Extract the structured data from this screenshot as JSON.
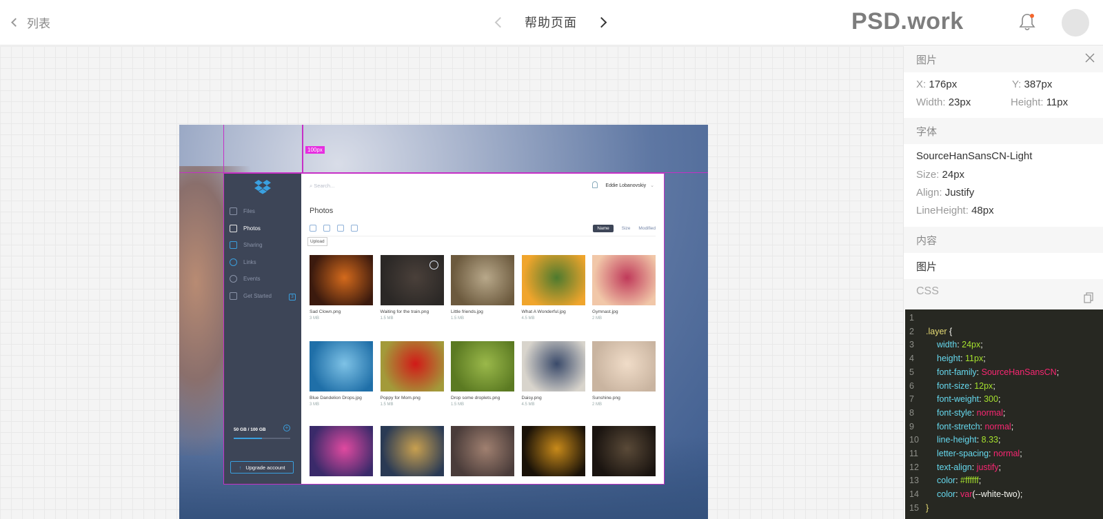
{
  "topbar": {
    "back_label": "列表",
    "page_title": "帮助页面",
    "brand": "PSD.work"
  },
  "artboard": {
    "measure_label": "100px",
    "app": {
      "search_placeholder": "Search...",
      "user_name": "Eddie Lobanovskiy",
      "title": "Photos",
      "upload_tooltip": "Upload",
      "sort": [
        "Name",
        "Size",
        "Modified"
      ],
      "sidebar": [
        {
          "label": "Files",
          "icon": "file-icon"
        },
        {
          "label": "Photos",
          "icon": "photos-icon"
        },
        {
          "label": "Sharing",
          "icon": "sharing-icon"
        },
        {
          "label": "Links",
          "icon": "link-icon"
        },
        {
          "label": "Events",
          "icon": "events-icon"
        },
        {
          "label": "Get Started",
          "icon": "get-started-icon",
          "badge": "3"
        }
      ],
      "storage": "50 GB / 100 GB",
      "storage_progress": 0.5,
      "upgrade_label": "Upgrade account",
      "photos": [
        {
          "name": "Sad Clown.png",
          "size": "3 MB",
          "colors": [
            "#3b1a0e",
            "#d46a1c"
          ]
        },
        {
          "name": "Waiting for the train.png",
          "size": "1.5 MB",
          "colors": [
            "#2b2826",
            "#4a403a"
          ],
          "selected": true
        },
        {
          "name": "Little friends.jpg",
          "size": "1.5 MB",
          "colors": [
            "#6c5a3e",
            "#b8a88a"
          ]
        },
        {
          "name": "What A Wonderful.jpg",
          "size": "4.5 MB",
          "colors": [
            "#f0a52c",
            "#4d7a2e"
          ]
        },
        {
          "name": "Gymnast.jpg",
          "size": "2 MB",
          "colors": [
            "#f1c7a8",
            "#c03a5a"
          ]
        },
        {
          "name": "Blue Dandelion Drops.jpg",
          "size": "3 MB",
          "colors": [
            "#1f6fa8",
            "#7ec2e6"
          ]
        },
        {
          "name": "Poppy for Mom.png",
          "size": "1.5 MB",
          "colors": [
            "#a39a3a",
            "#d11a18"
          ]
        },
        {
          "name": "Drop some droplets.png",
          "size": "1.5 MB",
          "colors": [
            "#5b7a22",
            "#9ab84a"
          ]
        },
        {
          "name": "Daisy.png",
          "size": "4.5 MB",
          "colors": [
            "#d8d4cc",
            "#3a4a6a"
          ]
        },
        {
          "name": "Sunshine.png",
          "size": "2 MB",
          "colors": [
            "#c9b4a0",
            "#f0dcc8"
          ]
        },
        {
          "name": "",
          "size": "",
          "colors": [
            "#3a2a6a",
            "#e04aa0"
          ]
        },
        {
          "name": "",
          "size": "",
          "colors": [
            "#2a3a54",
            "#c8a050"
          ]
        },
        {
          "name": "",
          "size": "",
          "colors": [
            "#4a3c3a",
            "#a08070"
          ]
        },
        {
          "name": "",
          "size": "",
          "colors": [
            "#1a1208",
            "#c88a1a"
          ]
        },
        {
          "name": "",
          "size": "",
          "colors": [
            "#1a1410",
            "#5a4a38"
          ]
        }
      ]
    }
  },
  "inspector": {
    "section_image": "图片",
    "x_label": "X:",
    "x_value": "176px",
    "y_label": "Y:",
    "y_value": "387px",
    "w_label": "Width:",
    "w_value": "23px",
    "h_label": "Height:",
    "h_value": "11px",
    "section_font": "字体",
    "font_name": "SourceHanSansCN-Light",
    "size_label": "Size:",
    "size_value": "24px",
    "align_label": "Align:",
    "align_value": "Justify",
    "lh_label": "LineHeight:",
    "lh_value": "48px",
    "section_content": "内容",
    "content_value": "图片",
    "section_css": "CSS",
    "code": [
      {
        "n": "1",
        "parts": []
      },
      {
        "n": "2",
        "parts": [
          [
            ".layer",
            "sel-k"
          ],
          [
            " {",
            "punc"
          ]
        ]
      },
      {
        "n": "3",
        "parts": [
          [
            "width",
            "prop-k"
          ],
          [
            ": ",
            "punc"
          ],
          [
            "24px",
            "num"
          ],
          [
            ";",
            "punc"
          ]
        ]
      },
      {
        "n": "4",
        "parts": [
          [
            "height",
            "prop-k"
          ],
          [
            ": ",
            "punc"
          ],
          [
            "11px",
            "num"
          ],
          [
            ";",
            "punc"
          ]
        ]
      },
      {
        "n": "5",
        "parts": [
          [
            "font-family",
            "prop-k"
          ],
          [
            ": ",
            "punc"
          ],
          [
            "SourceHanSansCN",
            "kw"
          ],
          [
            ";",
            "punc"
          ]
        ]
      },
      {
        "n": "6",
        "parts": [
          [
            "font-size",
            "prop-k"
          ],
          [
            ": ",
            "punc"
          ],
          [
            "12px",
            "num"
          ],
          [
            ";",
            "punc"
          ]
        ]
      },
      {
        "n": "7",
        "parts": [
          [
            "font-weight",
            "prop-k"
          ],
          [
            ": ",
            "punc"
          ],
          [
            "300",
            "num"
          ],
          [
            ";",
            "punc"
          ]
        ]
      },
      {
        "n": "8",
        "parts": [
          [
            "font-style",
            "prop-k"
          ],
          [
            ": ",
            "punc"
          ],
          [
            "normal",
            "kw"
          ],
          [
            ";",
            "punc"
          ]
        ]
      },
      {
        "n": "9",
        "parts": [
          [
            "font-stretch",
            "prop-k"
          ],
          [
            ": ",
            "punc"
          ],
          [
            "normal",
            "kw"
          ],
          [
            ";",
            "punc"
          ]
        ]
      },
      {
        "n": "10",
        "parts": [
          [
            "line-height",
            "prop-k"
          ],
          [
            ": ",
            "punc"
          ],
          [
            "8.33",
            "num"
          ],
          [
            ";",
            "punc"
          ]
        ]
      },
      {
        "n": "11",
        "parts": [
          [
            "letter-spacing",
            "prop-k"
          ],
          [
            ": ",
            "punc"
          ],
          [
            "normal",
            "kw"
          ],
          [
            ";",
            "punc"
          ]
        ]
      },
      {
        "n": "12",
        "parts": [
          [
            "text-align",
            "prop-k"
          ],
          [
            ": ",
            "punc"
          ],
          [
            "justify",
            "kw"
          ],
          [
            ";",
            "punc"
          ]
        ]
      },
      {
        "n": "13",
        "parts": [
          [
            "color",
            "prop-k"
          ],
          [
            ": ",
            "punc"
          ],
          [
            "#ffffff",
            "num"
          ],
          [
            ";",
            "punc"
          ]
        ]
      },
      {
        "n": "14",
        "parts": [
          [
            "color",
            "prop-k"
          ],
          [
            ": ",
            "punc"
          ],
          [
            "var",
            "kw"
          ],
          [
            "(--white-two);",
            "punc"
          ]
        ]
      },
      {
        "n": "15",
        "parts": [
          [
            "}",
            "sel-k"
          ]
        ]
      }
    ]
  },
  "colors": {
    "accent": "#3aa0e0",
    "guide": "#c62fc6",
    "notification_dot": "#f5652a",
    "code_bg": "#272822"
  }
}
